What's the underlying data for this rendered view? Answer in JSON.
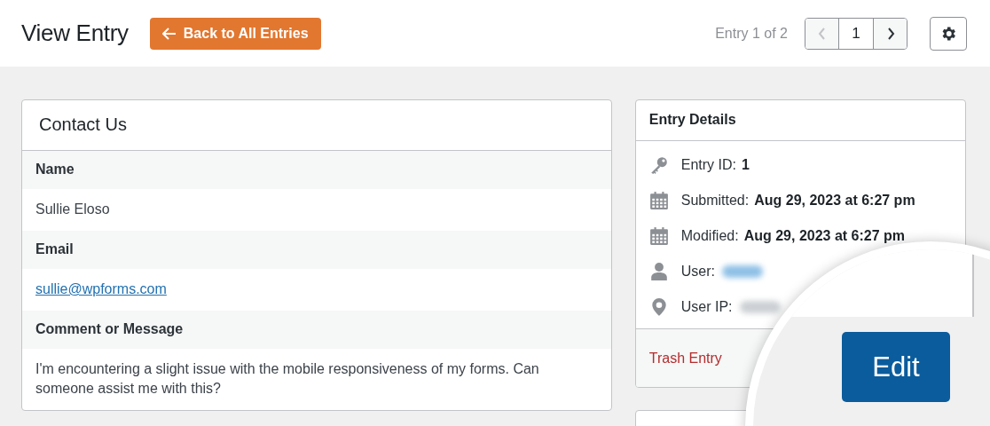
{
  "header": {
    "title": "View Entry",
    "back_button": "Back to All Entries",
    "entry_counter": "Entry 1 of 2",
    "pagination": {
      "current": "1",
      "prev_disabled": true,
      "next_disabled": false
    }
  },
  "form": {
    "title": "Contact Us",
    "fields": [
      {
        "label": "Name",
        "value": "Sullie Eloso",
        "kind": "text"
      },
      {
        "label": "Email",
        "value": "sullie@wpforms.com",
        "kind": "link"
      },
      {
        "label": "Comment or Message",
        "value": "I'm encountering a slight issue with the mobile responsiveness of my forms. Can someone assist me with this?",
        "kind": "text"
      }
    ]
  },
  "details": {
    "title": "Entry Details",
    "rows": [
      {
        "kind": "key",
        "label": "Entry ID:",
        "value": "1",
        "redacted": false
      },
      {
        "kind": "calendar",
        "label": "Submitted:",
        "value": "Aug 29, 2023 at 6:27 pm",
        "redacted": false
      },
      {
        "kind": "calendar",
        "label": "Modified:",
        "value": "Aug 29, 2023 at 6:27 pm",
        "redacted": false
      },
      {
        "kind": "user",
        "label": "User:",
        "redacted": true,
        "link": true
      },
      {
        "kind": "pin",
        "label": "User IP:",
        "redacted": true,
        "link": false
      }
    ],
    "trash": "Trash Entry",
    "edit": "Edit"
  }
}
